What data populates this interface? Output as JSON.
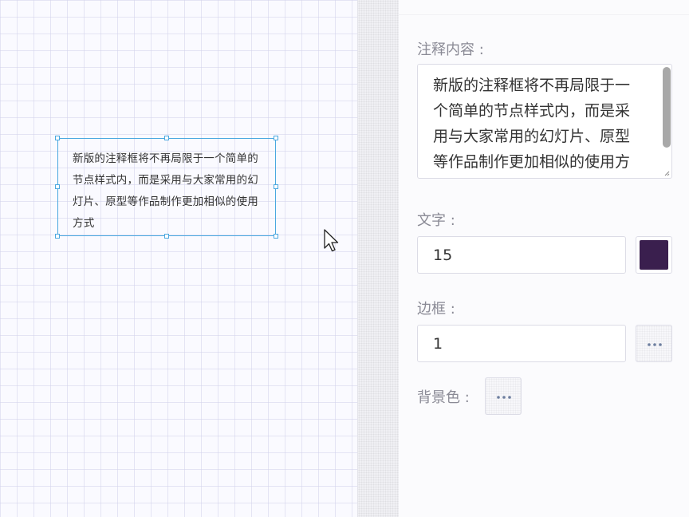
{
  "canvas": {
    "annotation": {
      "text": "新版的注释框将不再局限于一个简单的节点样式内，而是采用与大家常用的幻灯片、原型等作品制作更加相似的使用方式"
    }
  },
  "panel": {
    "content_label": "注释内容 :",
    "content_value": "新版的注释框将不再局限于一个简单的节点样式内，而是采用与大家常用的幻灯片、原型等作品制作更加相似的使用方式",
    "text_label": "文字 :",
    "text_size": "15",
    "text_color": "#3a1f4e",
    "border_label": "边框 :",
    "border_width": "1",
    "bg_label": "背景色 :"
  },
  "icons": {
    "cursor": "mouse-pointer-icon",
    "more": "more-dots-icon",
    "resize": "resize-grip-icon"
  },
  "colors": {
    "selection": "#4aa8e0",
    "canvas_bg": "#fafaff",
    "panel_bg": "#fbfbfd"
  }
}
